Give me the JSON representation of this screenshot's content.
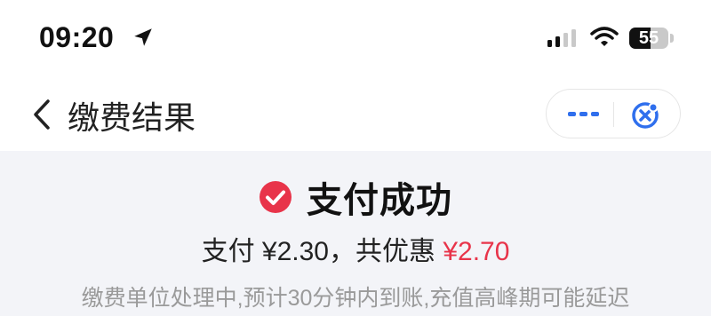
{
  "status_bar": {
    "time": "09:20",
    "battery_level": "55",
    "battery_fraction": 0.55,
    "icons": [
      "location-arrow-icon",
      "signal-icon",
      "wifi-icon",
      "battery-icon"
    ]
  },
  "nav": {
    "title": "缴费结果",
    "back_icon": "chevron-left-icon",
    "capsule_icons": [
      "more-icon",
      "close-mini-program-icon"
    ],
    "accent_color": "#2f6fed"
  },
  "result": {
    "status_title": "支付成功",
    "icon": "check-circle-icon",
    "icon_color": "#e8344a",
    "paid_label": "支付",
    "paid_amount": "¥2.30",
    "separator": "，",
    "discount_label": "共优惠",
    "discount_amount": "¥2.70",
    "discount_color": "#e8344a",
    "notice": "缴费单位处理中,预计30分钟内到账,充值高峰期可能延迟"
  }
}
